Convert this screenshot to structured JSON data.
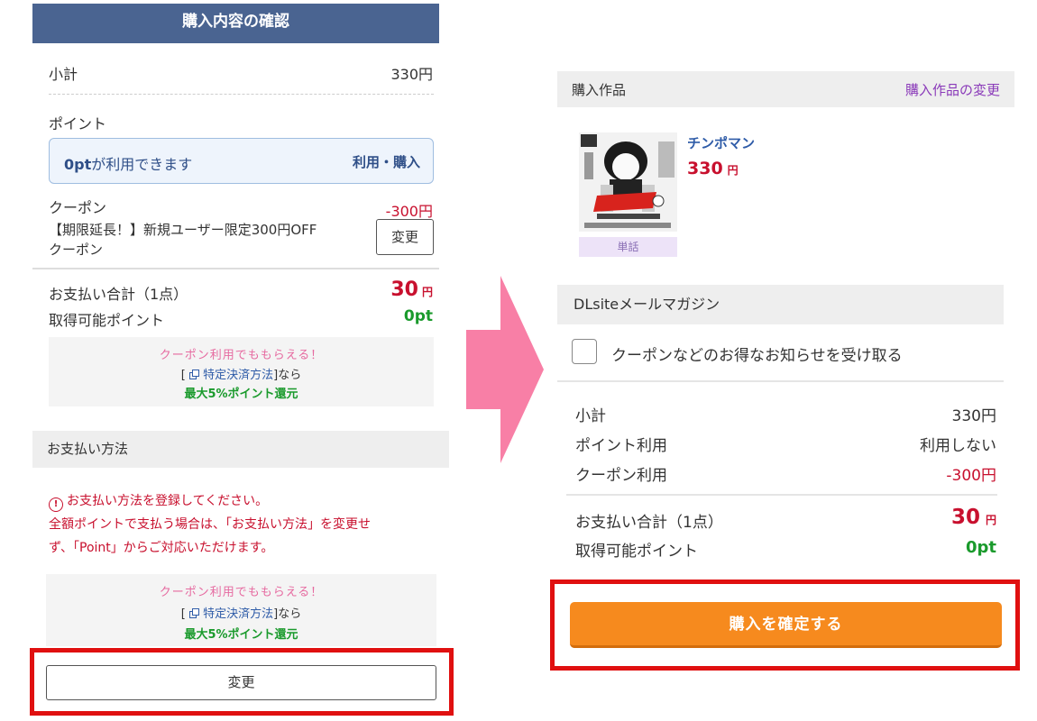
{
  "left": {
    "header_title": "購入内容の確認",
    "subtotal": {
      "label": "小計",
      "value": "330円"
    },
    "points": {
      "label": "ポイント",
      "available_amount": "0pt",
      "available_text": "が利用できます",
      "action": "利用・購入"
    },
    "coupon": {
      "label": "クーポン",
      "discount": "-300円",
      "name_line1": "【期限延長！】新規ユーザー限定300円OFF",
      "name_line2": "クーポン",
      "change_label": "変更"
    },
    "total": {
      "label": "お支払い合計（1点）",
      "amount": "30",
      "unit": "円",
      "points_label": "取得可能ポイント",
      "points_value": "0pt"
    },
    "promo": {
      "line1": "クーポン利用でももらえる！",
      "bracket_open": "[",
      "link_text": "特定決済方法",
      "bracket_close": "]なら",
      "line3": "最大5%ポイント還元"
    },
    "payment_method": {
      "header": "お支払い方法",
      "warning_icon": "!",
      "warning_line1": "お支払い方法を登録してください。",
      "warning_line2": "全額ポイントで支払う場合は、「お支払い方法」を変更せ",
      "warning_line3": "ず、「Point」からご対応いただけます。"
    },
    "change_button": "変更"
  },
  "right": {
    "works_header": {
      "title": "購入作品",
      "change_link": "購入作品の変更"
    },
    "work": {
      "title": "チンポマン",
      "price": "330",
      "unit": "円",
      "badge": "単話"
    },
    "mail_magazine": {
      "header": "DLsiteメールマガジン",
      "checkbox_label": "クーポンなどのお得なお知らせを受け取る",
      "checked": false
    },
    "summary": {
      "subtotal_label": "小計",
      "subtotal_value": "330円",
      "point_use_label": "ポイント利用",
      "point_use_value": "利用しない",
      "coupon_use_label": "クーポン利用",
      "coupon_use_value": "-300円"
    },
    "total": {
      "label": "お支払い合計（1点）",
      "amount": "30",
      "unit": "円",
      "points_label": "取得可能ポイント",
      "points_value": "0pt"
    },
    "confirm_button": "購入を確定する"
  },
  "colors": {
    "header_blue": "#4a6491",
    "price_red": "#c8102e",
    "point_green": "#1a9a2c",
    "confirm_orange": "#f68a1e",
    "highlight_frame_red": "#e01010",
    "arrow_pink": "#f87fa6"
  },
  "icons": [
    "warning-circle-icon",
    "external-link-icon",
    "arrow-right-icon"
  ]
}
